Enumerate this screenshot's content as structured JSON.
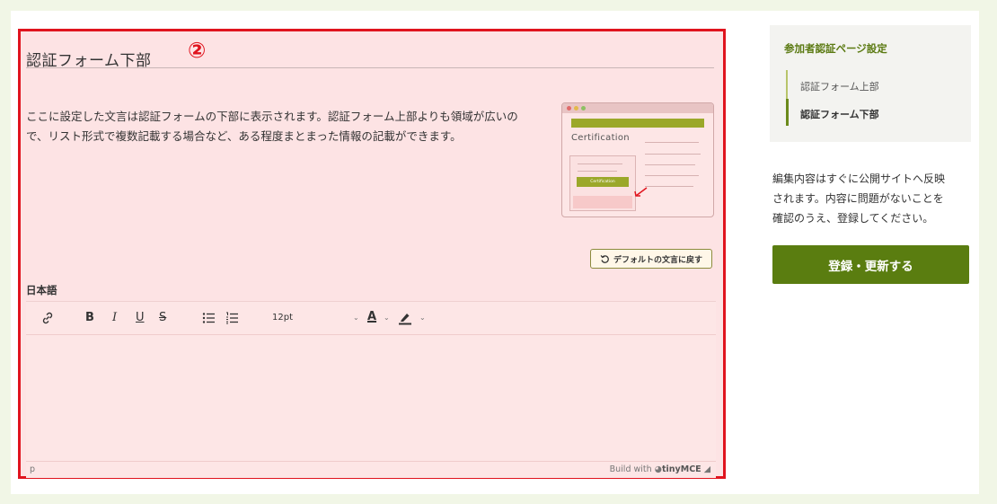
{
  "section": {
    "title": "認証フォーム下部",
    "marker": "②",
    "description_line1": "ここに設定した文言は認証フォームの下部に表示されます。認証フォーム上部よりも領域が広いの",
    "description_line2": "で、リスト形式で複数記載する場合など、ある程度まとまった情報の記載ができます。",
    "preview": {
      "heading": "Certification",
      "button_label": "Certification"
    },
    "reset_button": "デフォルトの文言に戻す",
    "language_label": "日本語"
  },
  "editor": {
    "font_size": "12pt",
    "toolbar": {
      "bold": "B",
      "italic": "I",
      "underline": "U",
      "strike": "S",
      "text_color": "A"
    },
    "status_path": "p",
    "brand_prefix": "Build with",
    "brand_name": "tinyMCE"
  },
  "sidebar": {
    "title": "参加者認証ページ設定",
    "items": [
      {
        "label": "認証フォーム上部",
        "active": false
      },
      {
        "label": "認証フォーム下部",
        "active": true
      }
    ]
  },
  "note": {
    "line1": "編集内容はすぐに公開サイトへ反映",
    "line2": "されます。内容に問題がないことを",
    "line3": "確認のうえ、登録してください。"
  },
  "submit_button": "登録・更新する",
  "colors": {
    "accent_green": "#5a7d10",
    "highlight_red": "#e0141e",
    "panel_pink": "#fde3e4"
  }
}
